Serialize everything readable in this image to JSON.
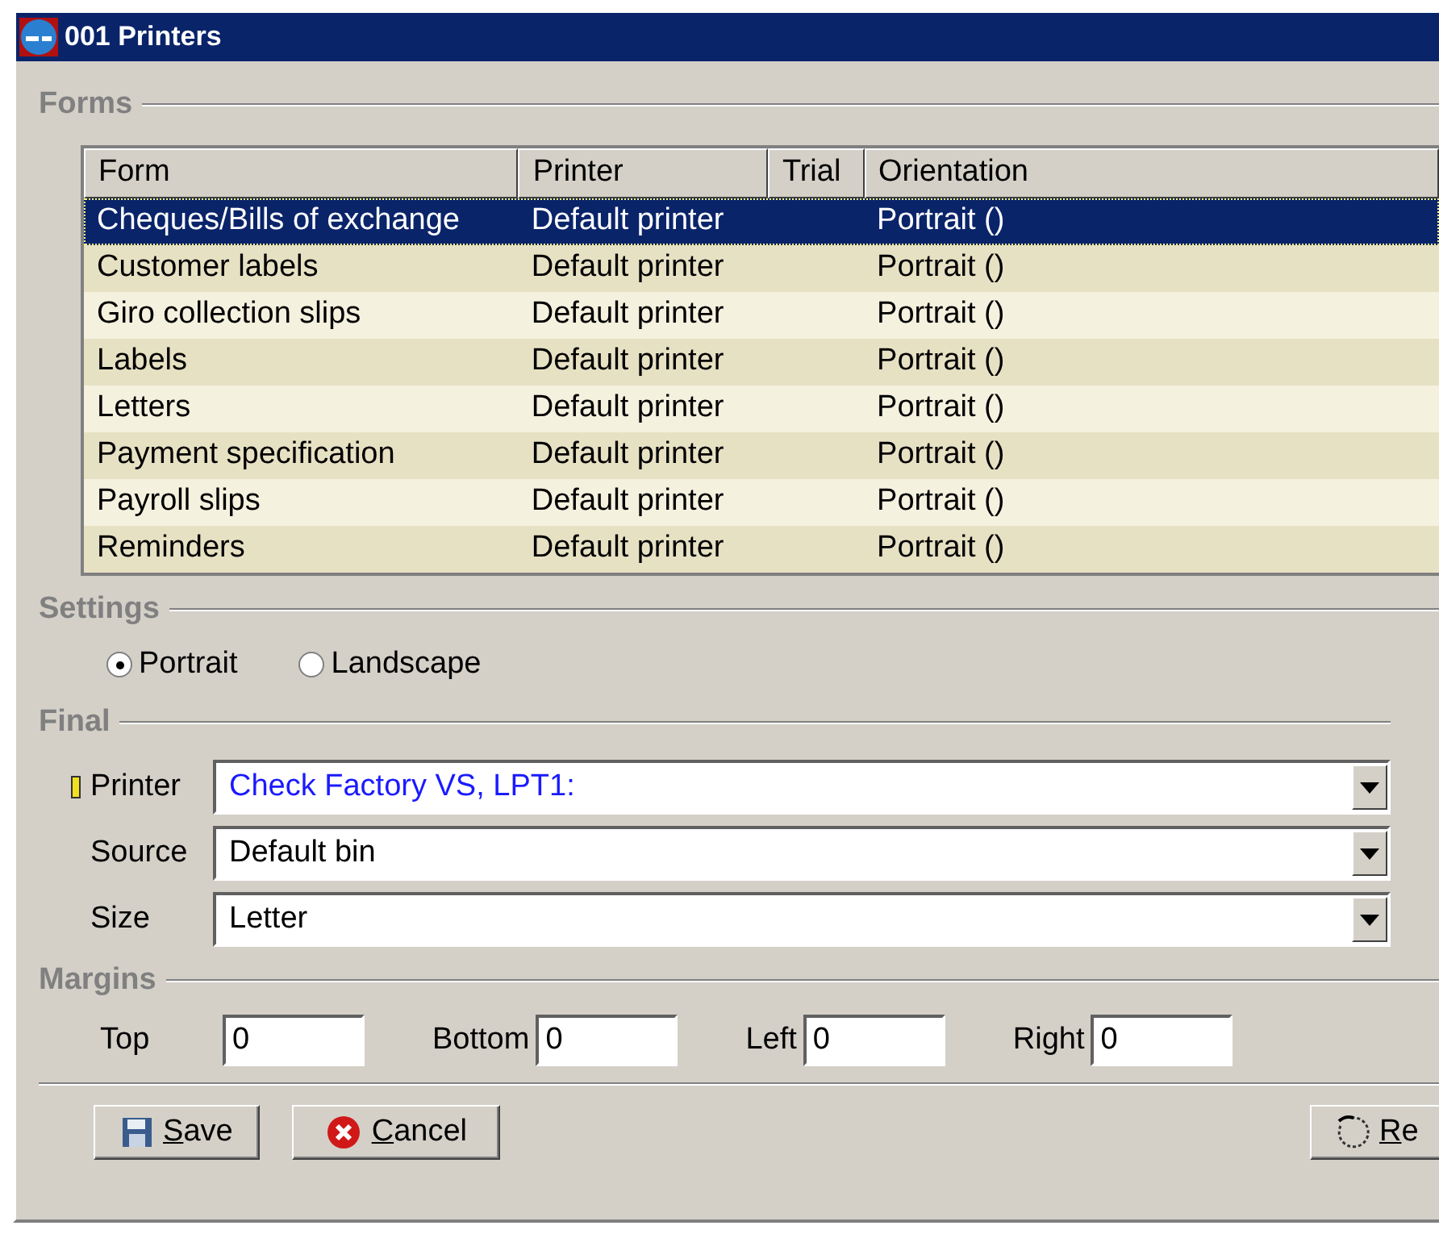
{
  "window": {
    "title": "001 Printers"
  },
  "forms": {
    "heading": "Forms",
    "columns": [
      "Form",
      "Printer",
      "Trial",
      "Orientation"
    ],
    "rows": [
      {
        "cells": [
          "Cheques/Bills of exchange",
          "Default printer",
          "",
          "Portrait ()"
        ],
        "selected": true
      },
      {
        "cells": [
          "Customer labels",
          "Default printer",
          "",
          "Portrait ()"
        ],
        "selected": false
      },
      {
        "cells": [
          "Giro collection slips",
          "Default printer",
          "",
          "Portrait ()"
        ],
        "selected": false
      },
      {
        "cells": [
          "Labels",
          "Default printer",
          "",
          "Portrait ()"
        ],
        "selected": false
      },
      {
        "cells": [
          "Letters",
          "Default printer",
          "",
          "Portrait ()"
        ],
        "selected": false
      },
      {
        "cells": [
          "Payment specification",
          "Default printer",
          "",
          "Portrait ()"
        ],
        "selected": false
      },
      {
        "cells": [
          "Payroll slips",
          "Default printer",
          "",
          "Portrait ()"
        ],
        "selected": false
      },
      {
        "cells": [
          "Reminders",
          "Default printer",
          "",
          "Portrait ()"
        ],
        "selected": false
      }
    ]
  },
  "settings": {
    "heading": "Settings",
    "options": [
      {
        "label": "Portrait",
        "selected": true
      },
      {
        "label": "Landscape",
        "selected": false
      }
    ]
  },
  "final": {
    "heading": "Final",
    "fields": [
      {
        "label": "Printer",
        "value": "Check Factory VS, LPT1:",
        "required": true
      },
      {
        "label": "Source",
        "value": "Default bin",
        "required": false
      },
      {
        "label": "Size",
        "value": "Letter",
        "required": false
      }
    ]
  },
  "margins": {
    "heading": "Margins",
    "fields": [
      {
        "label": "Top",
        "value": "0"
      },
      {
        "label": "Bottom",
        "value": "0"
      },
      {
        "label": "Left",
        "value": "0"
      },
      {
        "label": "Right",
        "value": "0"
      }
    ]
  },
  "buttons": [
    {
      "label": "Save",
      "kind": "save"
    },
    {
      "label": "Cancel",
      "kind": "cancel"
    },
    {
      "label": "Re",
      "kind": "reset"
    }
  ]
}
